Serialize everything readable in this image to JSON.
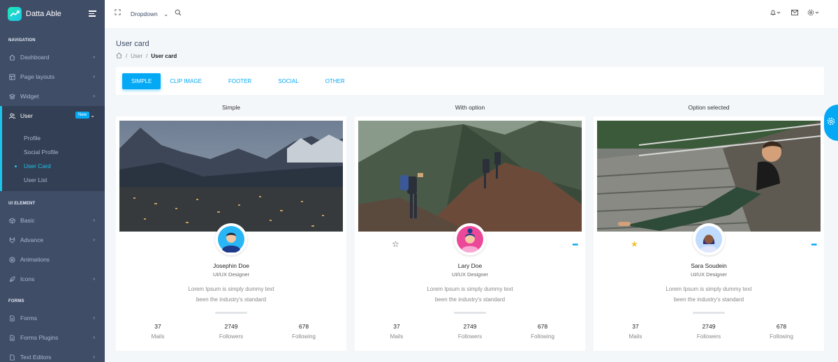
{
  "brand": {
    "name": "Datta Able"
  },
  "sidebar": {
    "caption_navigation": "NAVIGATION",
    "caption_ui": "UI ELEMENT",
    "caption_forms": "FORMS",
    "items": [
      {
        "label": "Dashboard"
      },
      {
        "label": "Page layouts"
      },
      {
        "label": "Widget"
      },
      {
        "label": "User",
        "badge": "New"
      },
      {
        "label": "Basic"
      },
      {
        "label": "Advance"
      },
      {
        "label": "Animations"
      },
      {
        "label": "Icons"
      },
      {
        "label": "Forms"
      },
      {
        "label": "Forms Plugins"
      },
      {
        "label": "Text Editors"
      }
    ],
    "user_sub": [
      "Profile",
      "Social Profile",
      "User Card",
      "User List"
    ]
  },
  "header": {
    "dropdown_label": "Dropdown"
  },
  "page": {
    "title": "User card",
    "breadcrumb": [
      "User",
      "User card"
    ]
  },
  "tabs": [
    "SIMPLE",
    "CLIP IMAGE",
    "FOOTER",
    "SOCIAL",
    "OTHER"
  ],
  "cards": [
    {
      "heading": "Simple",
      "name": "Josephin Doe",
      "role": "UI/UX Designer",
      "desc1": "Lorem Ipsum is simply dummy text",
      "desc2": "been the industry's standard",
      "stats": [
        {
          "value": "37",
          "label": "Mails"
        },
        {
          "value": "2749",
          "label": "Followers"
        },
        {
          "value": "678",
          "label": "Following"
        }
      ]
    },
    {
      "heading": "With option",
      "name": "Lary Doe",
      "role": "UI/UX Designer",
      "desc1": "Lorem Ipsum is simply dummy text",
      "desc2": "been the industry's standard",
      "stats": [
        {
          "value": "37",
          "label": "Mails"
        },
        {
          "value": "2749",
          "label": "Followers"
        },
        {
          "value": "678",
          "label": "Following"
        }
      ]
    },
    {
      "heading": "Option selected",
      "name": "Sara Soudein",
      "role": "UI/UX Designer",
      "desc1": "Lorem Ipsum is simply dummy text",
      "desc2": "been the industry's standard",
      "stats": [
        {
          "value": "37",
          "label": "Mails"
        },
        {
          "value": "2749",
          "label": "Followers"
        },
        {
          "value": "678",
          "label": "Following"
        }
      ]
    }
  ],
  "colors": {
    "sidebar": "#3f4d67",
    "accent": "#04a9f5",
    "teal": "#1dc4e9",
    "star_selected": "#f4c22b"
  }
}
